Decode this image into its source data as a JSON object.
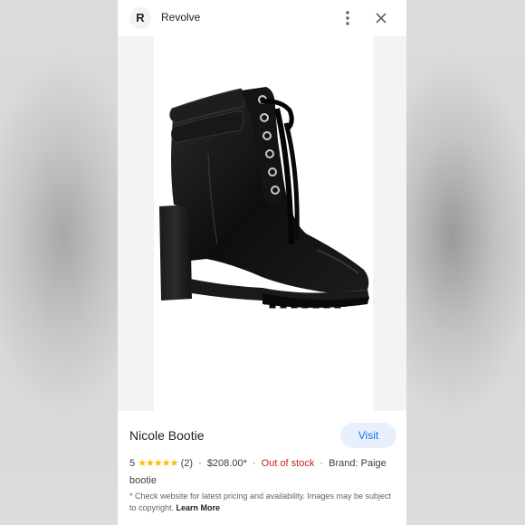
{
  "header": {
    "logo_letter": "R",
    "site_name": "Revolve",
    "menu_icon": "more-vert-icon",
    "close_icon": "close-icon"
  },
  "product_image": {
    "icon": "black-lace-up-heeled-boot",
    "background_color": "#f1f3f4"
  },
  "product": {
    "title": "Nicole Bootie",
    "visit_label": "Visit",
    "rating": "5",
    "stars": "★★★★★",
    "review_count": "(2)",
    "price": "$208.00*",
    "stock_status": "Out of stock",
    "brand": "Brand: Paige",
    "category": "bootie",
    "separator": "·",
    "disclaimer": "* Check website for latest pricing and availability. Images may be subject to copyright.",
    "learn_more": "Learn More"
  },
  "colors": {
    "accent": "#1a73e8",
    "visit_bg": "#e8f0fe",
    "star": "#fbbc04",
    "out_of_stock": "#c5221f"
  }
}
